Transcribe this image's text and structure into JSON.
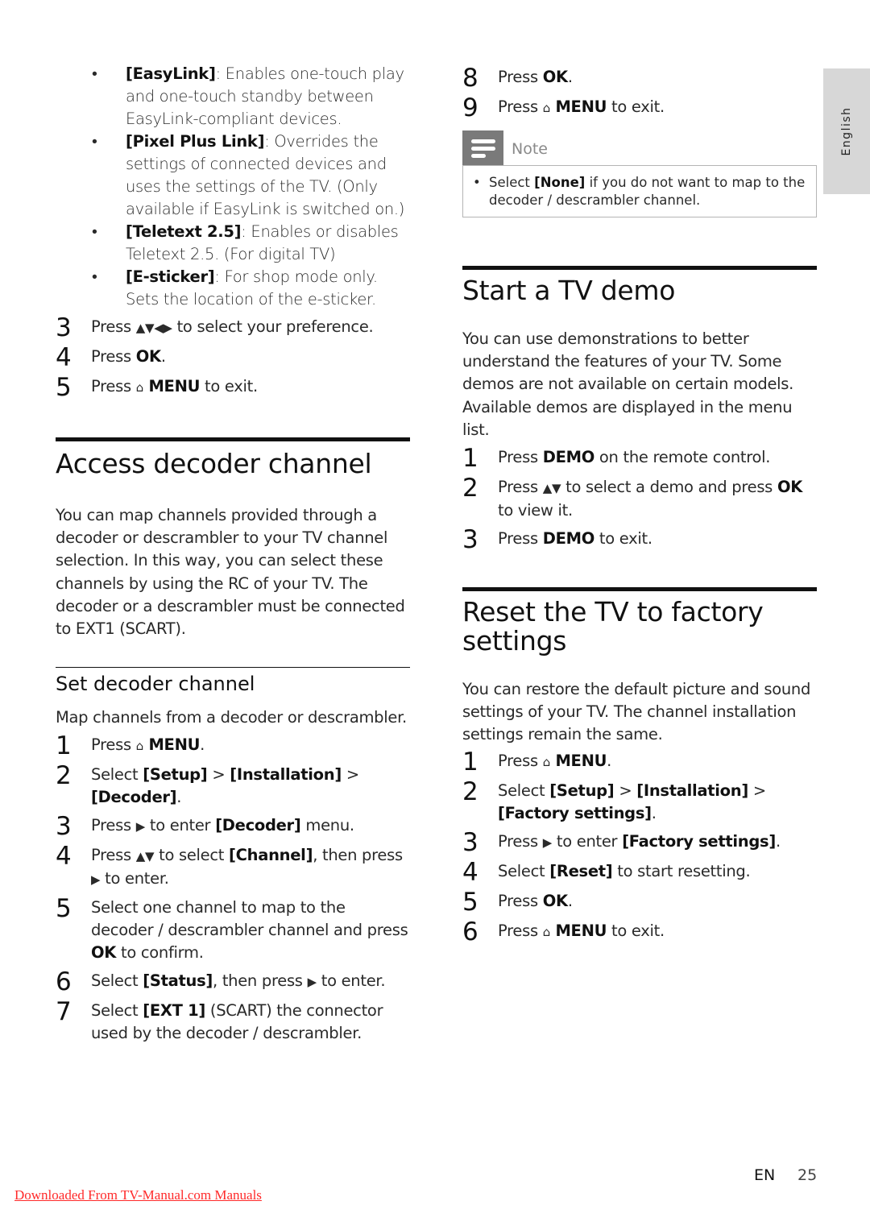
{
  "side_tab": {
    "label": "English"
  },
  "left": {
    "bullets": [
      {
        "key": "[EasyLink]",
        "text": ": Enables one-touch play and one-touch standby between EasyLink-compliant devices."
      },
      {
        "key": "[Pixel Plus Link]",
        "text": ": Overrides the settings of connected devices and uses the settings of the TV. (Only available if EasyLink is switched on.)"
      },
      {
        "key": "[Teletext 2.5]",
        "text": ": Enables or disables Teletext 2.5. (For digital TV)"
      },
      {
        "key": "[E-sticker]",
        "text": ": For shop mode only. Sets the location of the e-sticker."
      }
    ],
    "steps_top": [
      {
        "num": "3",
        "pre": "Press ",
        "icon": "▲▼◀▶",
        "post": " to select your preference."
      },
      {
        "num": "4",
        "pre": "Press ",
        "bold": "OK",
        "post": "."
      },
      {
        "num": "5",
        "pre": "Press ",
        "icon": "⌂",
        "bold": "MENU",
        "post": " to exit."
      }
    ],
    "section": {
      "title": "Access decoder channel",
      "intro": "You can map channels provided through a decoder or descrambler to your TV channel selection. In this way, you can select these channels by using the RC of your TV. The decoder or a descrambler must be connected to EXT1 (SCART).",
      "subsection": {
        "title": "Set decoder channel",
        "intro": "Map channels from a decoder or descrambler.",
        "steps": [
          {
            "num": "1",
            "parts": [
              [
                "t",
                "Press "
              ],
              [
                "i",
                "⌂"
              ],
              [
                "b",
                " MENU"
              ],
              [
                "t",
                "."
              ]
            ]
          },
          {
            "num": "2",
            "parts": [
              [
                "t",
                "Select "
              ],
              [
                "b",
                "[Setup]"
              ],
              [
                "t",
                " > "
              ],
              [
                "b",
                "[Installation]"
              ],
              [
                "t",
                " > "
              ],
              [
                "b",
                "[Decoder]"
              ],
              [
                "t",
                "."
              ]
            ]
          },
          {
            "num": "3",
            "parts": [
              [
                "t",
                "Press "
              ],
              [
                "i",
                "▶"
              ],
              [
                "t",
                " to enter "
              ],
              [
                "b",
                "[Decoder]"
              ],
              [
                "t",
                " menu."
              ]
            ]
          },
          {
            "num": "4",
            "parts": [
              [
                "t",
                "Press "
              ],
              [
                "i",
                "▲▼"
              ],
              [
                "t",
                " to select "
              ],
              [
                "b",
                "[Channel]"
              ],
              [
                "t",
                ", then press "
              ],
              [
                "i",
                "▶"
              ],
              [
                "t",
                " to enter."
              ]
            ]
          },
          {
            "num": "5",
            "parts": [
              [
                "t",
                "Select one channel to map to the decoder / descrambler channel and press "
              ],
              [
                "b",
                "OK"
              ],
              [
                "t",
                " to confirm."
              ]
            ]
          },
          {
            "num": "6",
            "parts": [
              [
                "t",
                "Select "
              ],
              [
                "b",
                "[Status]"
              ],
              [
                "t",
                ", then press "
              ],
              [
                "i",
                "▶"
              ],
              [
                "t",
                " to enter."
              ]
            ]
          },
          {
            "num": "7",
            "parts": [
              [
                "t",
                "Select "
              ],
              [
                "b",
                "[EXT 1]"
              ],
              [
                "t",
                " (SCART) the connector used by the decoder / descrambler."
              ]
            ]
          }
        ]
      }
    }
  },
  "right": {
    "steps_top": [
      {
        "num": "8",
        "parts": [
          [
            "t",
            "Press "
          ],
          [
            "b",
            "OK"
          ],
          [
            "t",
            "."
          ]
        ]
      },
      {
        "num": "9",
        "parts": [
          [
            "t",
            "Press "
          ],
          [
            "i",
            "⌂"
          ],
          [
            "b",
            " MENU"
          ],
          [
            "t",
            " to exit."
          ]
        ]
      }
    ],
    "note": {
      "label": "Note",
      "parts": [
        [
          "t",
          "Select "
        ],
        [
          "b",
          "[None]"
        ],
        [
          "t",
          " if you do not want to map to the decoder / descrambler channel."
        ]
      ]
    },
    "demo": {
      "title": "Start a TV demo",
      "intro": "You can use demonstrations to better understand the features of your TV. Some demos are not available on certain models. Available demos are displayed in the menu list.",
      "steps": [
        {
          "num": "1",
          "parts": [
            [
              "t",
              "Press "
            ],
            [
              "b",
              "DEMO"
            ],
            [
              "t",
              " on the remote control."
            ]
          ]
        },
        {
          "num": "2",
          "parts": [
            [
              "t",
              "Press "
            ],
            [
              "i",
              "▲▼"
            ],
            [
              "t",
              " to select a demo and press "
            ],
            [
              "b",
              "OK"
            ],
            [
              "t",
              " to view it."
            ]
          ]
        },
        {
          "num": "3",
          "parts": [
            [
              "t",
              "Press "
            ],
            [
              "b",
              "DEMO"
            ],
            [
              "t",
              " to exit."
            ]
          ]
        }
      ]
    },
    "reset": {
      "title": "Reset the TV to factory settings",
      "intro": "You can restore the default picture and sound settings of your TV. The channel installation settings remain the same.",
      "steps": [
        {
          "num": "1",
          "parts": [
            [
              "t",
              "Press "
            ],
            [
              "i",
              "⌂"
            ],
            [
              "b",
              " MENU"
            ],
            [
              "t",
              "."
            ]
          ]
        },
        {
          "num": "2",
          "parts": [
            [
              "t",
              "Select "
            ],
            [
              "b",
              "[Setup]"
            ],
            [
              "t",
              " > "
            ],
            [
              "b",
              "[Installation]"
            ],
            [
              "t",
              " > "
            ],
            [
              "b",
              "[Factory settings]"
            ],
            [
              "t",
              "."
            ]
          ]
        },
        {
          "num": "3",
          "parts": [
            [
              "t",
              "Press "
            ],
            [
              "i",
              "▶"
            ],
            [
              "t",
              " to enter "
            ],
            [
              "b",
              "[Factory settings]"
            ],
            [
              "t",
              "."
            ]
          ]
        },
        {
          "num": "4",
          "parts": [
            [
              "t",
              "Select "
            ],
            [
              "b",
              "[Reset]"
            ],
            [
              "t",
              " to start resetting."
            ]
          ]
        },
        {
          "num": "5",
          "parts": [
            [
              "t",
              "Press "
            ],
            [
              "b",
              "OK"
            ],
            [
              "t",
              "."
            ]
          ]
        },
        {
          "num": "6",
          "parts": [
            [
              "t",
              "Press "
            ],
            [
              "i",
              "⌂"
            ],
            [
              "b",
              " MENU"
            ],
            [
              "t",
              " to exit."
            ]
          ]
        }
      ]
    }
  },
  "footer": {
    "lang": "EN",
    "page": "25",
    "download_link": "Downloaded From TV-Manual.com Manuals"
  }
}
